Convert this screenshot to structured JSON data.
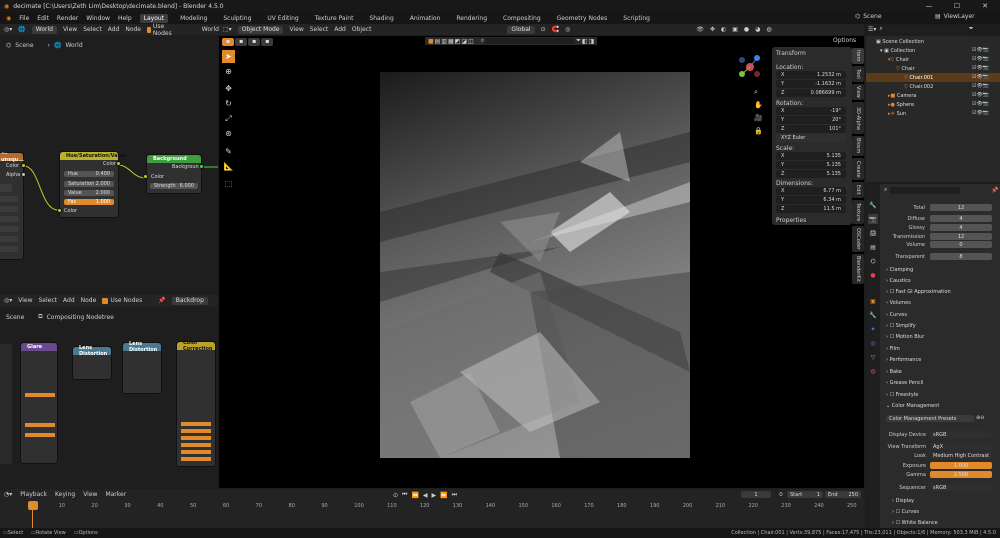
{
  "window": {
    "title": "decimate [C:\\Users\\Zeth Lim\\Desktop\\decimate.blend] - Blender 4.5.0"
  },
  "menu": [
    "File",
    "Edit",
    "Render",
    "Window",
    "Help"
  ],
  "workspaces": [
    "Layout",
    "Modeling",
    "Sculpting",
    "UV Editing",
    "Texture Paint",
    "Shading",
    "Animation",
    "Rendering",
    "Compositing",
    "Geometry Nodes",
    "Scripting"
  ],
  "scene": {
    "label": "Scene",
    "view_layer": "ViewLayer"
  },
  "shader_editor": {
    "header": {
      "type": "World",
      "menus": [
        "View",
        "Select",
        "Add",
        "Node"
      ],
      "use_nodes": "Use Nodes",
      "world": "World"
    },
    "breadcrumb": {
      "scene": "Scene",
      "world": "World"
    },
    "nodes": {
      "tex": {
        "title": "~-unsqu...",
        "color": "Color",
        "alpha": "Alpha"
      },
      "hsv": {
        "title": "Hue/Saturation/Value",
        "out": "Color",
        "fields": [
          {
            "l": "Hue",
            "v": "0.400"
          },
          {
            "l": "Saturation",
            "v": "2.000"
          },
          {
            "l": "Value",
            "v": "2.000"
          },
          {
            "l": "Fac",
            "v": "1.000"
          }
        ],
        "in": "Color"
      },
      "bg": {
        "title": "Background",
        "out": "Background",
        "color": "Color",
        "strength_label": "Strength",
        "strength": "6.000"
      }
    }
  },
  "compositor": {
    "header": {
      "menus": [
        "View",
        "Select",
        "Add",
        "Node"
      ],
      "use_nodes": "Use Nodes",
      "backdrop": "Backdrop"
    },
    "breadcrumb": {
      "scene": "Scene",
      "tree": "Compositing Nodetree"
    },
    "nodes": [
      "Glare",
      "Lens Distortion",
      "Lens Distortion",
      "Color Correction"
    ]
  },
  "viewport": {
    "mode": "Object Mode",
    "menus": [
      "View",
      "Select",
      "Add",
      "Object"
    ],
    "orientation": "Global",
    "options": "Options"
  },
  "transform": {
    "title": "Transform",
    "location_label": "Location:",
    "location": [
      {
        "a": "X",
        "v": "1.2532 m"
      },
      {
        "a": "Y",
        "v": "-1.1632 m"
      },
      {
        "a": "Z",
        "v": "0.086699 m"
      }
    ],
    "rotation_label": "Rotation:",
    "rotation": [
      {
        "a": "X",
        "v": "-19°"
      },
      {
        "a": "Y",
        "v": "20°"
      },
      {
        "a": "Z",
        "v": "101°"
      }
    ],
    "rot_mode": "XYZ Euler",
    "scale_label": "Scale:",
    "scale": [
      {
        "a": "X",
        "v": "5.135"
      },
      {
        "a": "Y",
        "v": "5.135"
      },
      {
        "a": "Z",
        "v": "5.135"
      }
    ],
    "dims_label": "Dimensions:",
    "dims": [
      {
        "a": "X",
        "v": "6.77 m"
      },
      {
        "a": "Y",
        "v": "6.34 m"
      },
      {
        "a": "Z",
        "v": "11.5 m"
      }
    ],
    "properties": "Properties"
  },
  "sidebar_tabs": [
    "Item",
    "Tool",
    "View",
    "3D-Alpha",
    "Blosm",
    "Create",
    "Edit",
    "Texture",
    "OSCoder",
    "BlenderKit"
  ],
  "outliner": {
    "search_placeholder": "",
    "root": "Scene Collection",
    "items": [
      "Collection",
      "Chair",
      "Chair",
      "Chair.001",
      "Chair.002",
      "Camera",
      "Sphere",
      "Sun"
    ]
  },
  "properties": {
    "search_placeholder": "",
    "light_paths": [
      {
        "l": "Total",
        "v": "12"
      },
      {
        "l": "Diffuse",
        "v": "4"
      },
      {
        "l": "Glossy",
        "v": "4"
      },
      {
        "l": "Transmission",
        "v": "12"
      },
      {
        "l": "Volume",
        "v": "0"
      },
      {
        "l": "Transparent",
        "v": "8"
      }
    ],
    "sections": [
      "Clamping",
      "Caustics",
      "Fast GI Approximation",
      "Volumes",
      "Curves",
      "Simplify",
      "Motion Blur",
      "Film",
      "Performance",
      "Bake",
      "Grease Pencil",
      "Freestyle",
      "Color Management"
    ],
    "cm": {
      "presets": "Color Management Presets",
      "rows": [
        {
          "l": "Display Device",
          "v": "sRGB"
        },
        {
          "l": "View Transform",
          "v": "AgX"
        },
        {
          "l": "Look",
          "v": "Medium High Contrast"
        },
        {
          "l": "Exposure",
          "v": "1.000"
        },
        {
          "l": "Gamma",
          "v": "2.500"
        },
        {
          "l": "Sequencer",
          "v": "sRGB"
        }
      ]
    },
    "tail": [
      "Display",
      "Curves",
      "White Balance"
    ]
  },
  "timeline": {
    "menus": [
      "Playback",
      "Keying",
      "View",
      "Marker"
    ],
    "current": "1",
    "start_label": "Start",
    "start": "1",
    "end_label": "End",
    "end": "250",
    "ticks": [
      "1",
      "10",
      "20",
      "30",
      "40",
      "50",
      "60",
      "70",
      "80",
      "90",
      "100",
      "110",
      "120",
      "130",
      "140",
      "150",
      "160",
      "170",
      "180",
      "190",
      "200",
      "210",
      "220",
      "230",
      "240",
      "250"
    ]
  },
  "status": {
    "left": [
      "Select",
      "Rotate View",
      "Options"
    ],
    "right": "Collection | Chair.001 | Verts:39,875 | Faces:17,475 | Tris:23,011 | Objects:1/6 | Memory: 503.3 MiB | 4.5.0"
  }
}
